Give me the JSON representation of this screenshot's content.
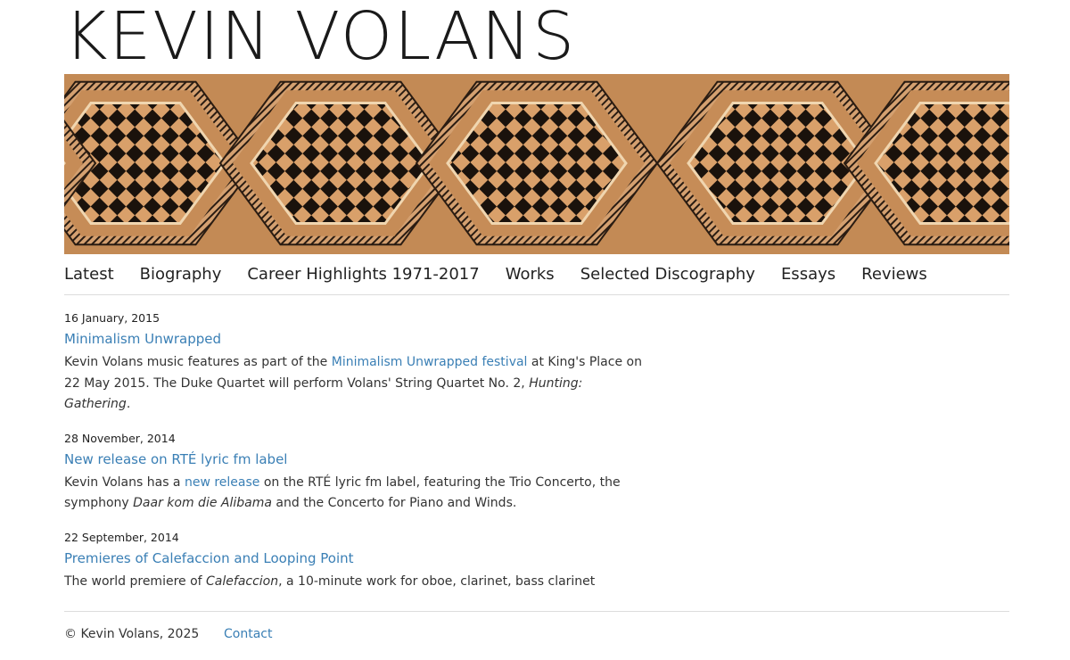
{
  "site": {
    "title": "KEVIN VOLANS"
  },
  "banner": {
    "image": "kuba-textile-pattern"
  },
  "nav": {
    "items": [
      {
        "label": "Latest"
      },
      {
        "label": "Biography"
      },
      {
        "label": "Career Highlights 1971-2017"
      },
      {
        "label": "Works"
      },
      {
        "label": "Selected Discography"
      },
      {
        "label": "Essays"
      },
      {
        "label": "Reviews"
      }
    ]
  },
  "posts": [
    {
      "date": "16 January, 2015",
      "title": "Minimalism Unwrapped",
      "body_1": "Kevin Volans music features as part of the ",
      "link": "Minimalism Unwrapped festival",
      "body_2": " at King's Place on 22 May 2015. The Duke Quartet will perform Volans' String Quartet No. 2, ",
      "italic": "Hunting: Gathering",
      "body_3": "."
    },
    {
      "date": "28 November, 2014",
      "title": "New release on RTÉ lyric fm label",
      "body_1": "Kevin Volans has a ",
      "link": "new release",
      "body_2": " on the RTÉ lyric fm label, featuring the Trio Concerto, the symphony ",
      "italic": "Daar kom die Alibama",
      "body_3": " and the Concerto for Piano and Winds."
    },
    {
      "date": "22 September, 2014",
      "title": "Premieres of Calefaccion and Looping Point",
      "body_1": "The world premiere of ",
      "italic": "Calefaccion",
      "body_2": ", a 10-minute work for oboe, clarinet, bass clarinet"
    }
  ],
  "footer": {
    "copyright": "© Kevin Volans, 2025",
    "contact": "Contact"
  },
  "colors": {
    "link": "#3a7fb5",
    "text": "#333333",
    "banner_tan": "#c8925a",
    "banner_dark": "#1a120c"
  }
}
